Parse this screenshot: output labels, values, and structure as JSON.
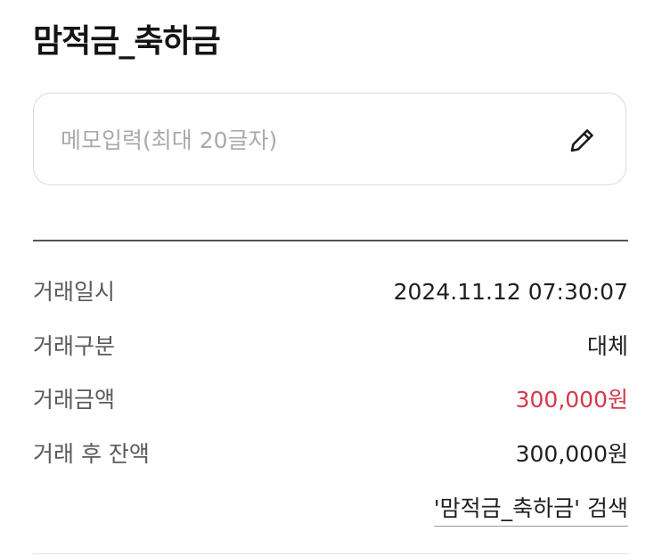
{
  "header": {
    "title": "맘적금_축하금"
  },
  "memo": {
    "placeholder": "메모입력(최대 20글자)",
    "value": "",
    "icon": "pencil-icon"
  },
  "details": [
    {
      "label": "거래일시",
      "value": "2024.11.12 07:30:07"
    },
    {
      "label": "거래구분",
      "value": "대체"
    },
    {
      "label": "거래금액",
      "value": "300,000원",
      "color": "#d4394a"
    },
    {
      "label": "거래 후 잔액",
      "value": "300,000원"
    }
  ],
  "search_link": {
    "label": "'맘적금_축하금' 검색"
  }
}
